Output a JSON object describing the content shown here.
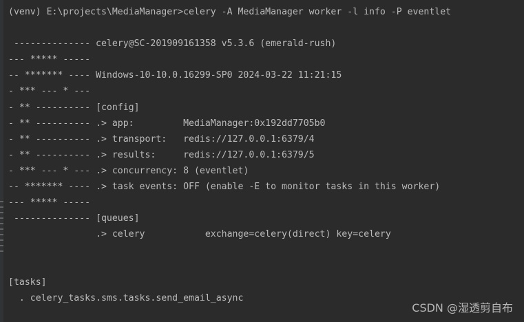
{
  "terminal": {
    "lines": [
      "(venv) E:\\projects\\MediaManager>celery -A MediaManager worker -l info -P eventlet",
      "",
      " -------------- celery@SC-201909161358 v5.3.6 (emerald-rush)",
      "--- ***** -----",
      "-- ******* ---- Windows-10-10.0.16299-SP0 2024-03-22 11:21:15",
      "- *** --- * ---",
      "- ** ---------- [config]",
      "- ** ---------- .> app:         MediaManager:0x192dd7705b0",
      "- ** ---------- .> transport:   redis://127.0.0.1:6379/4",
      "- ** ---------- .> results:     redis://127.0.0.1:6379/5",
      "- *** --- * --- .> concurrency: 8 (eventlet)",
      "-- ******* ---- .> task events: OFF (enable -E to monitor tasks in this worker)",
      "--- ***** -----",
      " -------------- [queues]",
      "                .> celery           exchange=celery(direct) key=celery",
      "",
      "",
      "[tasks]",
      "  . celery_tasks.sms.tasks.send_email_async"
    ]
  },
  "watermark": "CSDN @湿透剪自布",
  "colors": {
    "background": "#2b2b2b",
    "text": "#bbbbbb"
  }
}
